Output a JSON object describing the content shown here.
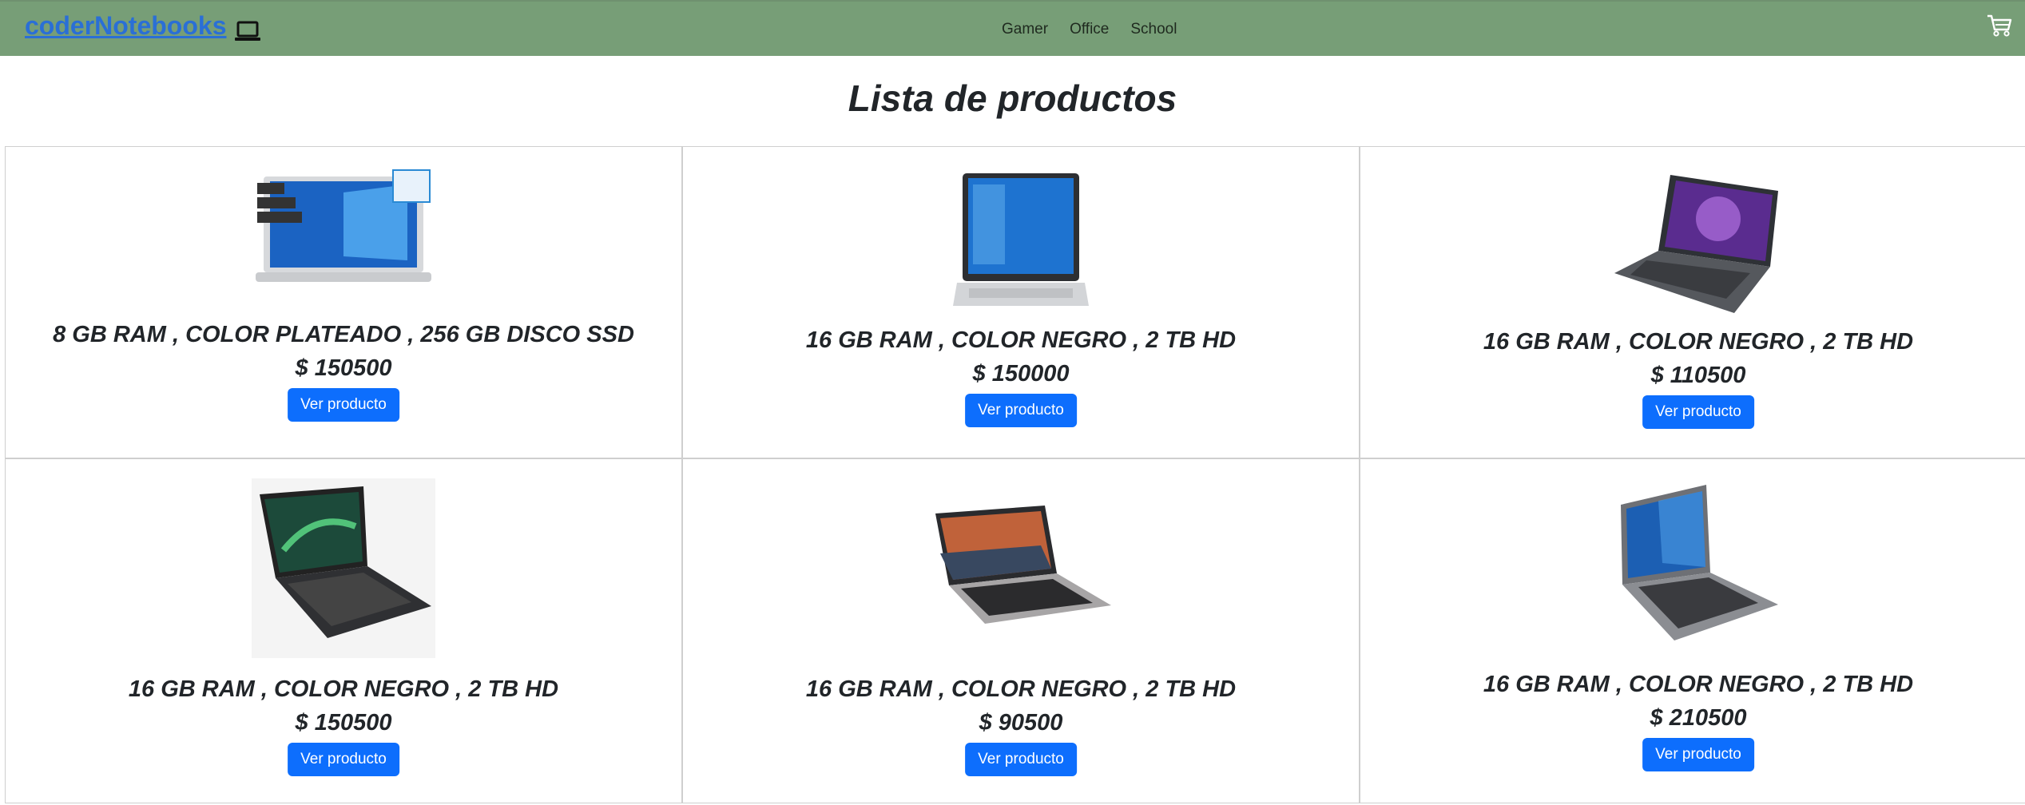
{
  "navbar": {
    "brand": "coderNotebooks",
    "brand_icon": "laptop-icon",
    "links": [
      "Gamer",
      "Office",
      "School"
    ],
    "cart_icon": "cart-icon",
    "background": "#779e77"
  },
  "page_title": "Lista de productos",
  "products": [
    {
      "description": "8 GB RAM , COLOR PLATEADO , 256 GB DISCO SSD",
      "price": "$ 150500",
      "button": "Ver producto",
      "image": "silver-laptop-image"
    },
    {
      "description": "16 GB RAM , COLOR NEGRO , 2 TB HD",
      "price": "$ 150000",
      "button": "Ver producto",
      "image": "silver-laptop-image"
    },
    {
      "description": "16 GB RAM , COLOR NEGRO , 2 TB HD",
      "price": "$ 110500",
      "button": "Ver producto",
      "image": "grey-laptop-image"
    },
    {
      "description": "16 GB RAM , COLOR NEGRO , 2 TB HD",
      "price": "$ 150500",
      "button": "Ver producto",
      "image": "black-laptop-image"
    },
    {
      "description": "16 GB RAM , COLOR NEGRO , 2 TB HD",
      "price": "$ 90500",
      "button": "Ver producto",
      "image": "silver-laptop-image"
    },
    {
      "description": "16 GB RAM , COLOR NEGRO , 2 TB HD",
      "price": "$ 210500",
      "button": "Ver producto",
      "image": "grey-laptop-image"
    }
  ],
  "colors": {
    "button": "#0d6efd",
    "link": "#2a6fd6"
  }
}
